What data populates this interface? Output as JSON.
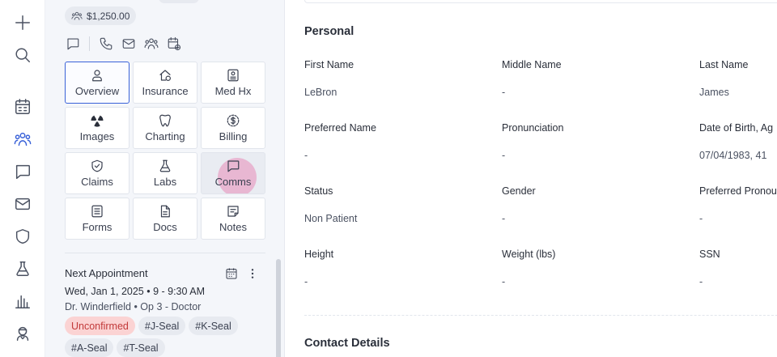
{
  "rail": {
    "items": [
      {
        "name": "add",
        "icon": "plus-icon"
      },
      {
        "name": "search",
        "icon": "search-icon"
      },
      {
        "name": "schedule",
        "icon": "calendar-grid-icon"
      },
      {
        "name": "patients",
        "icon": "people-icon",
        "active": true
      },
      {
        "name": "messages",
        "icon": "chat-icon"
      },
      {
        "name": "mail",
        "icon": "mail-icon"
      },
      {
        "name": "insurance",
        "icon": "shield-icon"
      },
      {
        "name": "labs",
        "icon": "flask-icon"
      },
      {
        "name": "reports",
        "icon": "bar-chart-icon"
      },
      {
        "name": "staff",
        "icon": "doctor-icon"
      }
    ]
  },
  "patient_panel": {
    "balance": "$1,250.00",
    "quick_actions": [
      "chat-icon",
      "phone-icon",
      "mail-icon",
      "people-icon",
      "calendar-add-icon"
    ],
    "tiles": [
      {
        "label": "Overview",
        "icon": "person-icon",
        "selected": true
      },
      {
        "label": "Insurance",
        "icon": "house-hand-icon"
      },
      {
        "label": "Med Hx",
        "icon": "id-card-icon"
      },
      {
        "label": "Images",
        "icon": "radiation-icon"
      },
      {
        "label": "Charting",
        "icon": "tooth-icon"
      },
      {
        "label": "Billing",
        "icon": "dollar-badge-icon"
      },
      {
        "label": "Claims",
        "icon": "shield-check-icon"
      },
      {
        "label": "Labs",
        "icon": "flask-icon"
      },
      {
        "label": "Comms",
        "icon": "chat-icon",
        "hover": true
      },
      {
        "label": "Forms",
        "icon": "form-icon"
      },
      {
        "label": "Docs",
        "icon": "document-icon"
      },
      {
        "label": "Notes",
        "icon": "note-icon"
      }
    ],
    "appointment": {
      "title": "Next Appointment",
      "date": "Wed, Jan 1, 2025 • 9 - 9:30 AM",
      "provider": "Dr. Winderfield • Op 3 - Doctor",
      "tags": [
        {
          "label": "Unconfirmed",
          "warn": true
        },
        {
          "label": "#J-Seal"
        },
        {
          "label": "#K-Seal"
        },
        {
          "label": "#A-Seal"
        },
        {
          "label": "#T-Seal"
        }
      ]
    }
  },
  "main": {
    "personal": {
      "title": "Personal",
      "fields": [
        {
          "label": "First Name",
          "value": "LeBron"
        },
        {
          "label": "Middle Name",
          "value": "-"
        },
        {
          "label": "Last Name",
          "value": "James"
        },
        {
          "label": "Preferred Name",
          "value": "-"
        },
        {
          "label": "Pronunciation",
          "value": "-"
        },
        {
          "label": "Date of Birth, Ag",
          "value": "07/04/1983, 41"
        },
        {
          "label": "Status",
          "value": "Non Patient"
        },
        {
          "label": "Gender",
          "value": "-"
        },
        {
          "label": "Preferred Pronou",
          "value": "-"
        },
        {
          "label": "Height",
          "value": "-"
        },
        {
          "label": "Weight (lbs)",
          "value": "-"
        },
        {
          "label": "SSN",
          "value": "-"
        }
      ]
    },
    "contact": {
      "title": "Contact Details"
    }
  },
  "colors": {
    "accent": "#3a62d8",
    "warn_bg": "#fbd3d3",
    "warn_text": "#c23a3a"
  }
}
